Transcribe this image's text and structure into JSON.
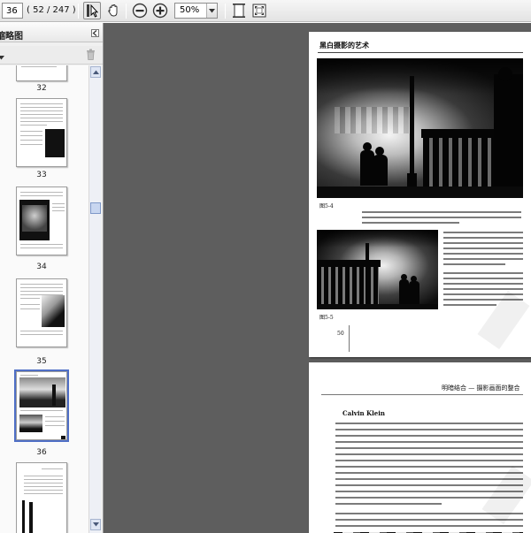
{
  "toolbar": {
    "page_number": "36",
    "page_count": "( 52 / 247 )",
    "zoom": "50%",
    "icons": [
      "select-cursor-icon",
      "hand-tool-icon",
      "zoom-out-icon",
      "zoom-in-icon",
      "fit-page-icon",
      "fit-width-icon"
    ]
  },
  "sidebar": {
    "title": "缩略图",
    "thumbnails": [
      {
        "label": "32"
      },
      {
        "label": "33"
      },
      {
        "label": "34"
      },
      {
        "label": "35"
      },
      {
        "label": "36"
      }
    ]
  },
  "document": {
    "page1": {
      "header": "黑白摄影的艺术",
      "caption1": "图5-4",
      "caption2": "图5-5",
      "page_number": "50"
    },
    "page2": {
      "header": "明暗结合 — 摄影画面的整合",
      "title": "Calvin Klein"
    }
  },
  "colors": {
    "selection_outline": "#4f6fc6",
    "main_background": "#5e5e5e"
  }
}
